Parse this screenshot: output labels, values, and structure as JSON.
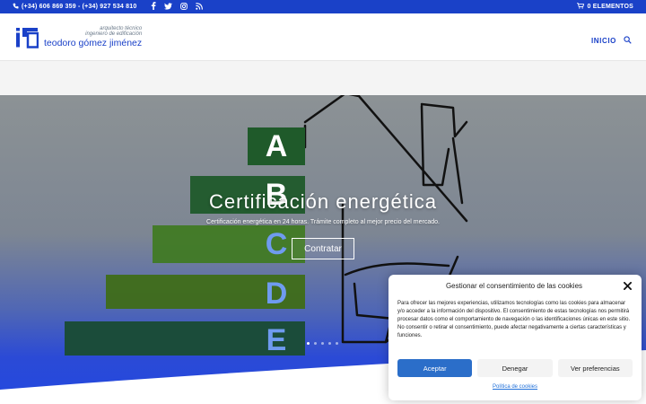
{
  "topbar": {
    "phones": "(+34) 606 869 359 - (+34) 927 534 810",
    "social": [
      "facebook-icon",
      "twitter-icon",
      "instagram-icon",
      "rss-icon"
    ],
    "cart_label": "0 ELEMENTOS"
  },
  "logo": {
    "line1": "arquitecto técnico",
    "line2": "ingeniero de edificación",
    "name": "teodoro gómez jiménez",
    "mark_color": "#1a41c8"
  },
  "nav": {
    "items": [
      "INICIO"
    ],
    "search_icon": "search-icon"
  },
  "hero": {
    "title": "Certificación energética",
    "subtitle": "Certificación energética en 24 horas. Trámite completo al mejor precio del mercado.",
    "cta_label": "Contratar",
    "energy_letters": [
      "A",
      "B",
      "C",
      "D",
      "E"
    ],
    "slide_count": 5,
    "active_slide": 1
  },
  "consent": {
    "title": "Gestionar el consentimiento de las cookies",
    "text": "Para ofrecer las mejores experiencias, utilizamos tecnologías como las cookies para almacenar y/o acceder a la información del dispositivo. El consentimiento de estas tecnologías nos permitirá procesar datos como el comportamiento de navegación o las identificaciones únicas en este sitio. No consentir o retirar el consentimiento, puede afectar negativamente a ciertas características y funciones.",
    "accept_label": "Aceptar",
    "deny_label": "Denegar",
    "prefs_label": "Ver preferencias",
    "policy_link": "Política de cookies"
  },
  "colors": {
    "brand_blue": "#1a41c8",
    "accept_blue": "#2b6ec9",
    "energy_green": "#1f5a2a"
  }
}
